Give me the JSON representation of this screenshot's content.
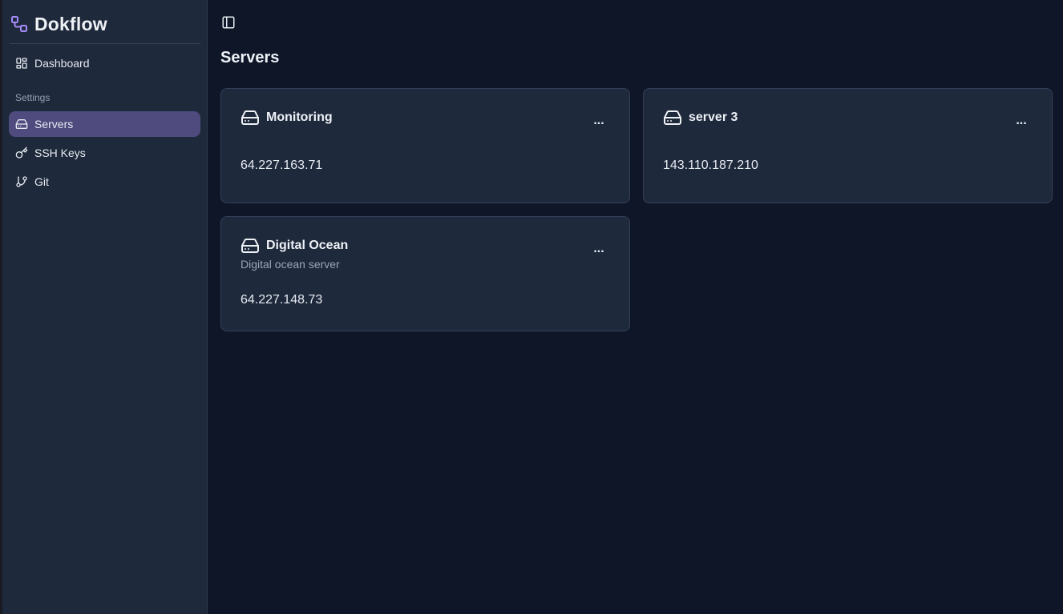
{
  "app": {
    "name": "Dokflow"
  },
  "sidebar": {
    "dashboard_label": "Dashboard",
    "settings_section": "Settings",
    "items": [
      {
        "label": "Servers",
        "icon": "hard-drive-icon",
        "active": true
      },
      {
        "label": "SSH Keys",
        "icon": "key-icon",
        "active": false
      },
      {
        "label": "Git",
        "icon": "git-branch-icon",
        "active": false
      }
    ]
  },
  "header": {
    "toggle_icon": "sidebar-toggle-icon"
  },
  "page": {
    "title": "Servers"
  },
  "servers": [
    {
      "name": "Monitoring",
      "description": "",
      "ip": "64.227.163.71",
      "menu": "..."
    },
    {
      "name": "server 3",
      "description": "",
      "ip": "143.110.187.210",
      "menu": "..."
    },
    {
      "name": "Digital Ocean",
      "description": "Digital ocean server",
      "ip": "64.227.148.73",
      "menu": "..."
    }
  ],
  "colors": {
    "background": "#0e1628",
    "sidebar": "#1e293b",
    "card": "#1e293b",
    "active_item": "#4f4b7e",
    "brand_accent": "#a78bfa"
  }
}
